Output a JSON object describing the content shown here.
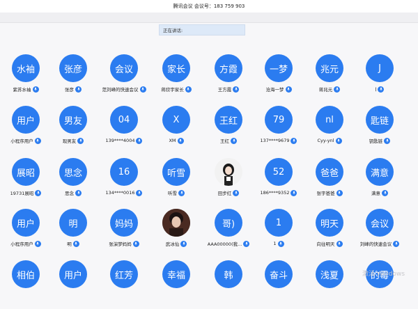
{
  "title_bar": {
    "text": "腾讯会议  会议号：183 759 903"
  },
  "speaking": {
    "label": "正在讲话:"
  },
  "watermark": {
    "text": "激活 Windows"
  },
  "colors": {
    "avatar_bg": "#2b7cf0",
    "mic_bg": "#2b7cf0"
  },
  "participants": [
    {
      "avatar": "水袖",
      "name": "紫苏水袖"
    },
    {
      "avatar": "张彦",
      "name": "张彦"
    },
    {
      "avatar": "会议",
      "name": "范刘峰的快速会议"
    },
    {
      "avatar": "家长",
      "name": "蒋欣宇家长"
    },
    {
      "avatar": "方霞",
      "name": "王方霞"
    },
    {
      "avatar": "一梦",
      "name": "沧海一梦"
    },
    {
      "avatar": "兆元",
      "name": "蒋兆元"
    },
    {
      "avatar": "J",
      "name": "J"
    },
    {
      "avatar": "用户",
      "name": "小程序用户"
    },
    {
      "avatar": "男友",
      "name": "现男友"
    },
    {
      "avatar": "04",
      "name": "139****4004"
    },
    {
      "avatar": "X",
      "name": "XM"
    },
    {
      "avatar": "王红",
      "name": "王红"
    },
    {
      "avatar": "79",
      "name": "137****9679"
    },
    {
      "avatar": "nl",
      "name": "Cyy-ynl"
    },
    {
      "avatar": "匙链",
      "name": "钥匙链"
    },
    {
      "avatar": "展昭",
      "name": "19731展昭"
    },
    {
      "avatar": "思念",
      "name": "思念"
    },
    {
      "avatar": "16",
      "name": "134****0016"
    },
    {
      "avatar": "听雪",
      "name": "听雪"
    },
    {
      "avatar": "",
      "name": "田步红",
      "photo": "girl"
    },
    {
      "avatar": "52",
      "name": "186****9352"
    },
    {
      "avatar": "爸爸",
      "name": "张宇爸爸"
    },
    {
      "avatar": "满意",
      "name": "满意"
    },
    {
      "avatar": "用户",
      "name": "小程序用户"
    },
    {
      "avatar": "明",
      "name": "明"
    },
    {
      "avatar": "妈妈",
      "name": "张演梦妈妈"
    },
    {
      "avatar": "",
      "name": "武冰仙",
      "photo": "boy"
    },
    {
      "avatar": "哥)",
      "name": "AAA00000(我..."
    },
    {
      "avatar": "1",
      "name": "1"
    },
    {
      "avatar": "明天",
      "name": "向往明天"
    },
    {
      "avatar": "会议",
      "name": "刘峰的快速会议"
    },
    {
      "avatar": "相伯",
      "name": ""
    },
    {
      "avatar": "用户",
      "name": ""
    },
    {
      "avatar": "红芳",
      "name": ""
    },
    {
      "avatar": "幸福",
      "name": ""
    },
    {
      "avatar": "韩",
      "name": ""
    },
    {
      "avatar": "奋斗",
      "name": ""
    },
    {
      "avatar": "浅夏",
      "name": ""
    },
    {
      "avatar": "的霉",
      "name": ""
    }
  ]
}
